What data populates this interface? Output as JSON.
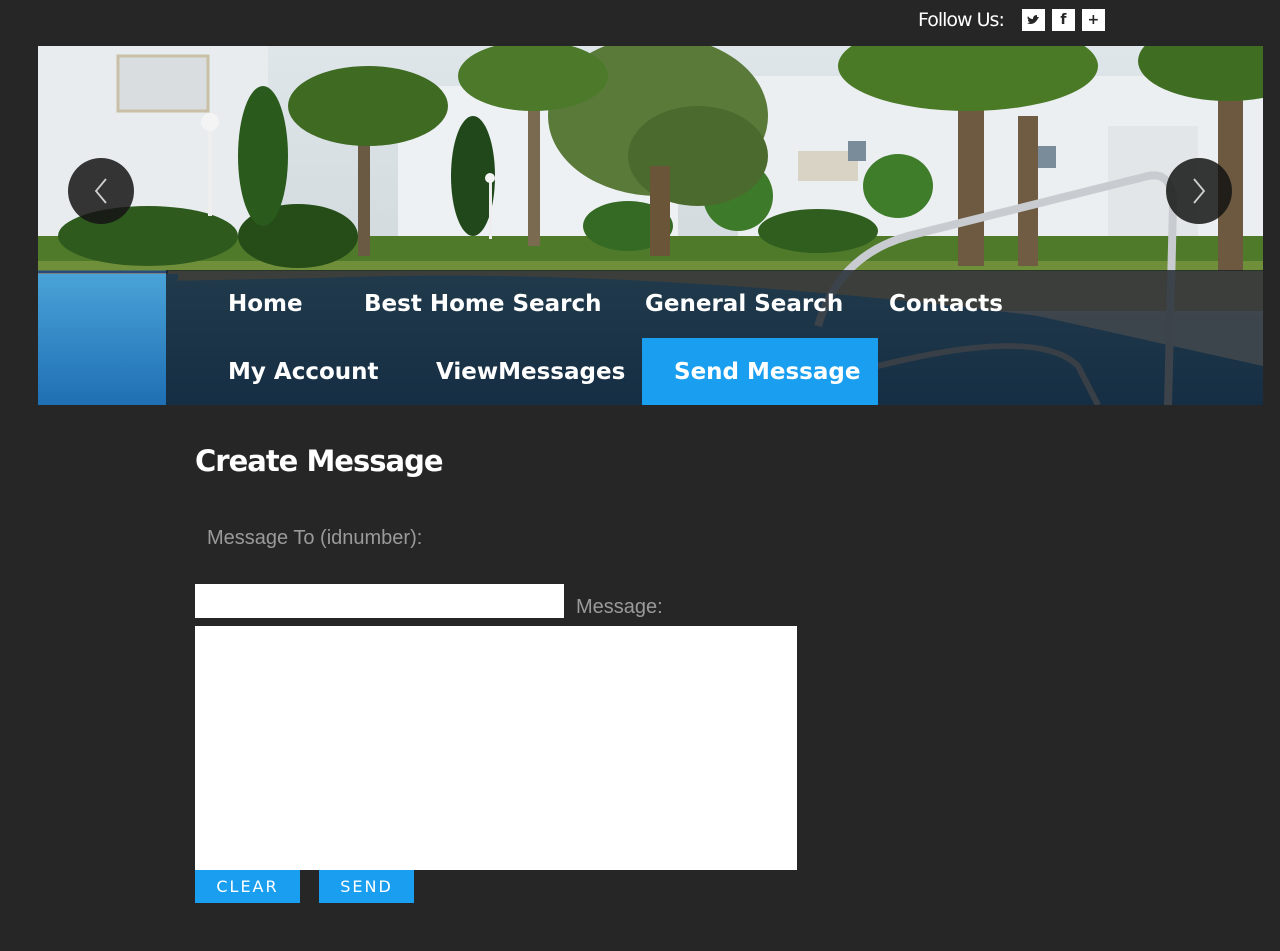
{
  "follow": {
    "label": "Follow Us:",
    "icons": [
      {
        "name": "twitter-icon",
        "glyph": "❧"
      },
      {
        "name": "facebook-icon",
        "glyph": "f"
      },
      {
        "name": "plus-icon",
        "glyph": "+"
      }
    ]
  },
  "hero": {
    "prev_icon": "chevron-left-icon",
    "next_icon": "chevron-right-icon"
  },
  "nav": {
    "items": [
      {
        "label": "Home"
      },
      {
        "label": "Best Home Search"
      },
      {
        "label": "General Search"
      },
      {
        "label": "Contacts"
      },
      {
        "label": "My Account"
      },
      {
        "label": "ViewMessages"
      },
      {
        "label": "Send Message",
        "active": true
      }
    ]
  },
  "form": {
    "title": "Create Message",
    "to_label": "Message To (idnumber):",
    "to_value": "",
    "message_label": "Message:",
    "message_value": "",
    "clear_label": "CLEAR",
    "send_label": "SEND"
  },
  "colors": {
    "background": "#262626",
    "accent": "#1a9ff0"
  }
}
